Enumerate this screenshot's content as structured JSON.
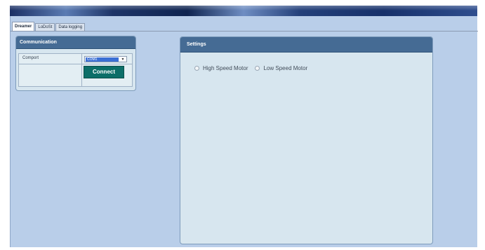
{
  "tabs": [
    {
      "label": "Dreamer",
      "active": true
    },
    {
      "label": "LoDoSt",
      "active": false
    },
    {
      "label": "Data logging",
      "active": false
    }
  ],
  "communication": {
    "title": "Communication",
    "comport_label": "Comport",
    "comport_value": "COM1",
    "connect_label": "Connect"
  },
  "settings": {
    "title": "Settings",
    "options": [
      {
        "label": "High Speed Motor",
        "selected": false
      },
      {
        "label": "Low Speed Motor",
        "selected": false
      }
    ]
  },
  "colors": {
    "background": "#b9cee9",
    "panel_header": "#456b94",
    "panel_body": "#d7e6ef",
    "connect_button": "#0c6e68",
    "selection": "#3b6fd4"
  },
  "icons": {
    "combo_arrow": "chevron-down-icon"
  }
}
